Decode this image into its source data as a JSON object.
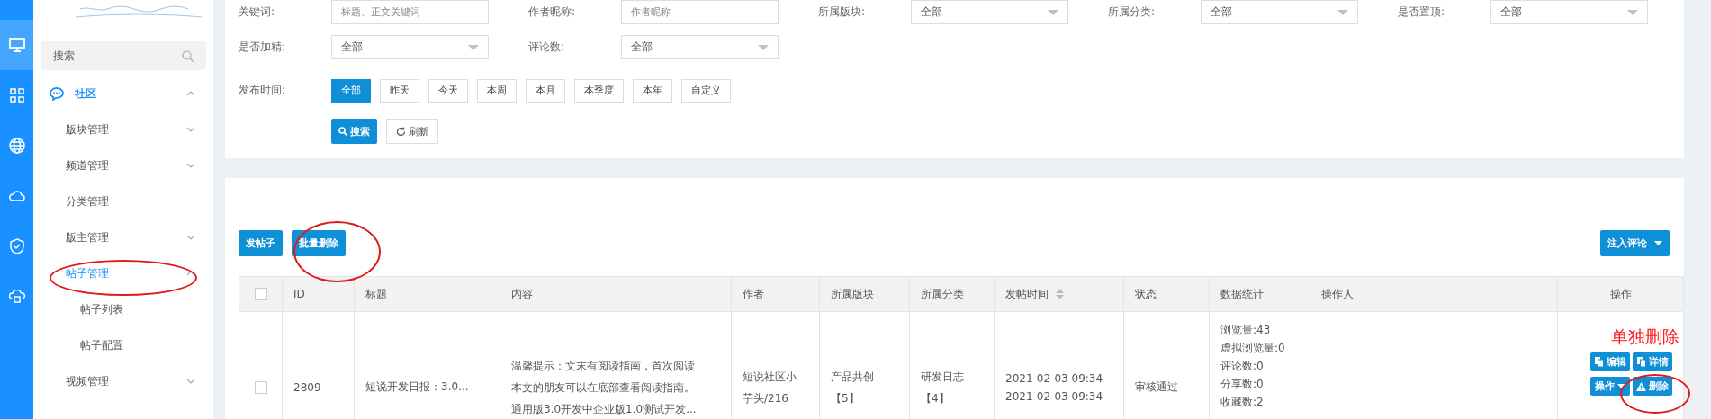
{
  "rail": [
    {
      "selected": true
    },
    {
      "selected": false
    },
    {
      "selected": false
    },
    {
      "selected": false
    },
    {
      "selected": false
    },
    {
      "selected": false
    }
  ],
  "sidebar": {
    "search": {
      "placeholder": "搜索"
    },
    "section": {
      "label": "社区",
      "expanded": true
    },
    "items": [
      {
        "label": "版块管理",
        "kind": "group",
        "expanded": false,
        "selected": false
      },
      {
        "label": "频道管理",
        "kind": "group",
        "expanded": false,
        "selected": false
      },
      {
        "label": "分类管理",
        "kind": "leaf",
        "selected": false
      },
      {
        "label": "版主管理",
        "kind": "group",
        "expanded": false,
        "selected": false
      },
      {
        "label": "帖子管理",
        "kind": "group",
        "expanded": true,
        "selected": true,
        "children": [
          {
            "label": "帖子列表",
            "selected": false
          },
          {
            "label": "帖子配置",
            "selected": false
          }
        ]
      },
      {
        "label": "视频管理",
        "kind": "group",
        "expanded": false,
        "selected": false
      }
    ]
  },
  "filters": [
    {
      "label": "关键词:",
      "kind": "input",
      "placeholder": "标题、正文关键词"
    },
    {
      "label": "作者昵称:",
      "kind": "input",
      "placeholder": "作者昵称"
    },
    {
      "label": "所属版块:",
      "kind": "select",
      "value": "全部"
    },
    {
      "label": "所属分类:",
      "kind": "select",
      "value": "全部"
    },
    {
      "label": "是否置顶:",
      "kind": "select",
      "value": "全部"
    },
    {
      "label": "是否加精:",
      "kind": "select",
      "value": "全部"
    },
    {
      "label": "评论数:",
      "kind": "select",
      "value": "全部"
    }
  ],
  "time_filter": {
    "label": "发布时间:",
    "options": [
      {
        "label": "全部",
        "selected": true
      },
      {
        "label": "昨天",
        "selected": false
      },
      {
        "label": "今天",
        "selected": false
      },
      {
        "label": "本周",
        "selected": false
      },
      {
        "label": "本月",
        "selected": false
      },
      {
        "label": "本季度",
        "selected": false
      },
      {
        "label": "本年",
        "selected": false
      },
      {
        "label": "自定义",
        "selected": false
      }
    ]
  },
  "search_button": "搜索",
  "refresh_button": "刷新",
  "toolbar": {
    "buttons": [
      "发帖子",
      "批量删除"
    ],
    "dropdown": "注入评论"
  },
  "table": {
    "header_checked": false,
    "columns": [
      {
        "label": "ID",
        "sortable": false
      },
      {
        "label": "标题",
        "sortable": false
      },
      {
        "label": "内容",
        "sortable": false
      },
      {
        "label": "作者",
        "sortable": false
      },
      {
        "label": "所属版块",
        "sortable": false
      },
      {
        "label": "所属分类",
        "sortable": false
      },
      {
        "label": "发帖时间",
        "sortable": true
      },
      {
        "label": "状态",
        "sortable": false
      },
      {
        "label": "数据统计",
        "sortable": false
      },
      {
        "label": "操作人",
        "sortable": false
      },
      {
        "label": "操作",
        "sortable": false
      }
    ],
    "rows": [
      {
        "checked": false,
        "id": "2809",
        "title": "短说开发日报：3.0...",
        "content": [
          "温馨提示：文末有阅读指南，首次阅读",
          "本文的朋友可以在底部查看阅读指南。",
          "通用版3.0开发中企业版1.0测试开发..."
        ],
        "author": [
          "短说社区小",
          "芋头/216"
        ],
        "block": [
          "产品共创",
          "【5】"
        ],
        "category": [
          "研发日志",
          "【4】"
        ],
        "times": [
          "2021-02-03 09:34",
          "2021-02-03 09:34"
        ],
        "status": "审核通过",
        "stats": [
          "浏览量:43",
          "虚拟浏览量:0",
          "评论数:0",
          "分享数:0",
          "收藏数:2"
        ],
        "actions": [
          {
            "label": "编辑",
            "kind": "copy"
          },
          {
            "label": "详情",
            "kind": "copy"
          },
          {
            "label": "操作",
            "kind": "dropdown"
          },
          {
            "label": "删除",
            "kind": "warning"
          }
        ]
      }
    ]
  },
  "annotation": "单独删除"
}
